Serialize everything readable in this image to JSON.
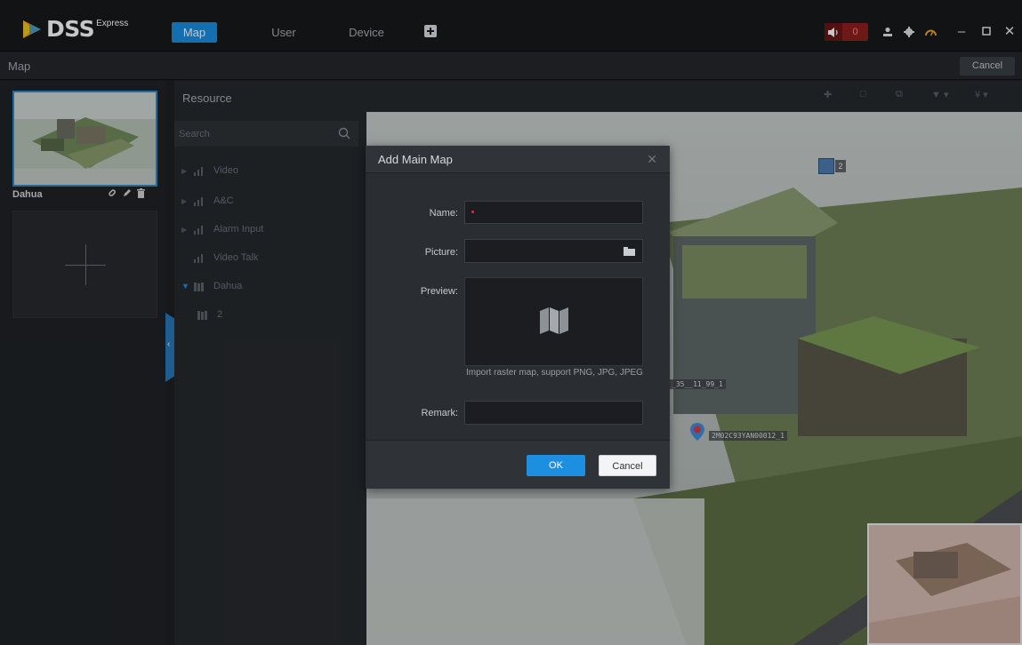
{
  "app": {
    "logo_text": "DSS",
    "logo_sup": "Express",
    "nav_tabs": [
      {
        "label": "Map",
        "active": true
      },
      {
        "label": "User",
        "active": false
      },
      {
        "label": "Device",
        "active": false
      }
    ],
    "alarm_count": "0",
    "accent_color": "#1c8fe0"
  },
  "header": {
    "title": "Map",
    "cancel_label": "Cancel"
  },
  "left_panel": {
    "maps": [
      {
        "name": "Dahua"
      }
    ]
  },
  "resource": {
    "title": "Resource",
    "search_placeholder": "Search",
    "tree": [
      {
        "label": "Video",
        "expanded": false
      },
      {
        "label": "A&C",
        "expanded": false
      },
      {
        "label": "Alarm Input",
        "expanded": false
      },
      {
        "label": "Video Talk",
        "expanded": false
      },
      {
        "label": "Dahua",
        "expanded": true
      },
      {
        "label": "2",
        "expanded": false
      }
    ]
  },
  "map": {
    "channel_badge": "2",
    "camera_label": "2M02C93YAN00012_1",
    "partial_label": "_35__11_99_1"
  },
  "dialog": {
    "title": "Add Main Map",
    "name_label": "Name:",
    "picture_label": "Picture:",
    "preview_label": "Preview:",
    "import_hint": "Import raster map, support PNG, JPG, JPEG",
    "remark_label": "Remark:",
    "ok_label": "OK",
    "cancel_label": "Cancel"
  }
}
